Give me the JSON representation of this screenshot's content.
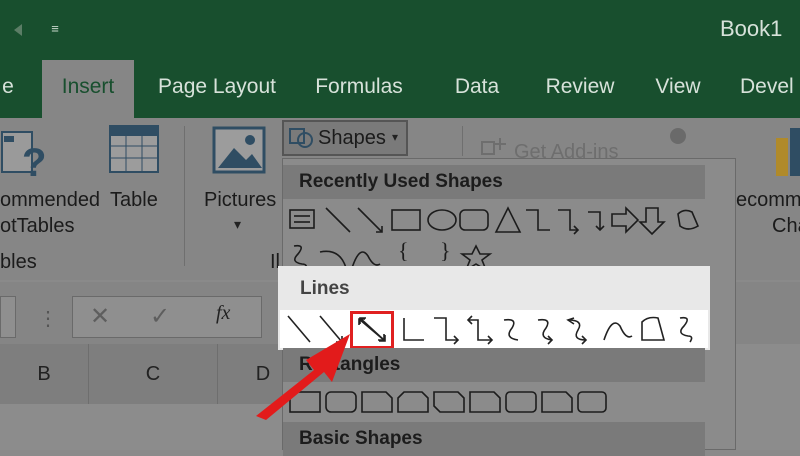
{
  "window": {
    "title": "Book1",
    "qat_dropdown": "≡"
  },
  "tabs": [
    {
      "label": "e"
    },
    {
      "label": "Insert"
    },
    {
      "label": "Page Layout"
    },
    {
      "label": "Formulas"
    },
    {
      "label": "Data"
    },
    {
      "label": "Review"
    },
    {
      "label": "View"
    },
    {
      "label": "Devel"
    }
  ],
  "ribbon": {
    "recommended_pivot_line1": "ommended",
    "recommended_pivot_line2": "otTables",
    "group_tables": "bles",
    "table": "Table",
    "pictures": "Pictures",
    "group_illus": "Il",
    "shapes": "Shapes",
    "get_addins": "Get Add-ins",
    "recommended_charts_line1": "ecomm",
    "recommended_charts_line2": "Cha"
  },
  "formula_bar": {
    "fx": "fx",
    "cancel": "✕",
    "enter": "✓"
  },
  "columns": [
    "B",
    "C",
    "D"
  ],
  "shapes_panel": {
    "recently_used": "Recently Used Shapes",
    "lines": "Lines",
    "rectangles": "Rectangles",
    "basic_shapes": "Basic Shapes",
    "recent_braces": [
      "{",
      "}"
    ],
    "highlighted_item": "double-arrow-line"
  },
  "colors": {
    "title_green": "#184f2e",
    "highlight_red": "#e02020"
  }
}
